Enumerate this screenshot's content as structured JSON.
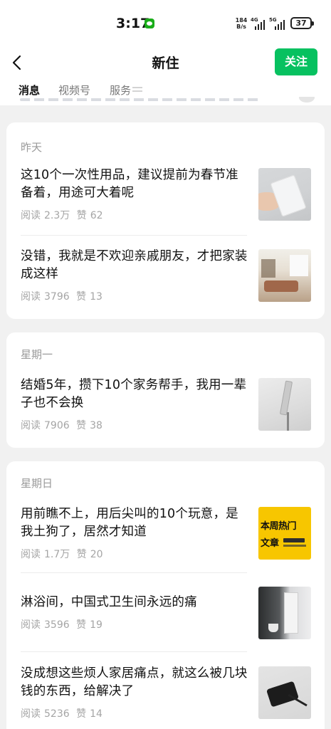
{
  "status_bar": {
    "time": "3:17",
    "net_speed_value": "184",
    "net_speed_unit": "B/s",
    "signal_1_label": "4G",
    "signal_2_label": "5G",
    "battery": "37",
    "app_notification_icon": "wechat-icon"
  },
  "nav": {
    "back_icon": "chevron-left-icon",
    "title": "新住",
    "follow_label": "关注"
  },
  "tabs": [
    {
      "label": "消息",
      "active": true
    },
    {
      "label": "视频号",
      "active": false
    },
    {
      "label": "服务",
      "active": false
    }
  ],
  "colors": {
    "accent": "#07c160",
    "background": "#f1f1f1",
    "card": "#ffffff",
    "muted_text": "#a5a5a5"
  },
  "groups": [
    {
      "day": "昨天",
      "articles": [
        {
          "title": "这10个一次性用品，建议提前为春节准备着，用途可大着呢",
          "read_label": "阅读",
          "reads": "2.3万",
          "like_label": "赞",
          "likes": "62"
        },
        {
          "title": "没错，我就是不欢迎亲戚朋友，才把家装成这样",
          "read_label": "阅读",
          "reads": "3796",
          "like_label": "赞",
          "likes": "13"
        }
      ]
    },
    {
      "day": "星期一",
      "articles": [
        {
          "title": "结婚5年，攒下10个家务帮手，我用一辈子也不会换",
          "read_label": "阅读",
          "reads": "7906",
          "like_label": "赞",
          "likes": "38"
        }
      ]
    },
    {
      "day": "星期日",
      "articles": [
        {
          "title": "用前瞧不上，用后尖叫的10个玩意，是我土狗了，居然才知道",
          "read_label": "阅读",
          "reads": "1.7万",
          "like_label": "赞",
          "likes": "20",
          "thumb_text_1": "本周热门",
          "thumb_text_2": "文章"
        },
        {
          "title": "淋浴间，中国式卫生间永远的痛",
          "read_label": "阅读",
          "reads": "3596",
          "like_label": "赞",
          "likes": "19"
        },
        {
          "title": "没成想这些烦人家居痛点，就这么被几块钱的东西，给解决了",
          "read_label": "阅读",
          "reads": "5236",
          "like_label": "赞",
          "likes": "14"
        }
      ]
    }
  ]
}
